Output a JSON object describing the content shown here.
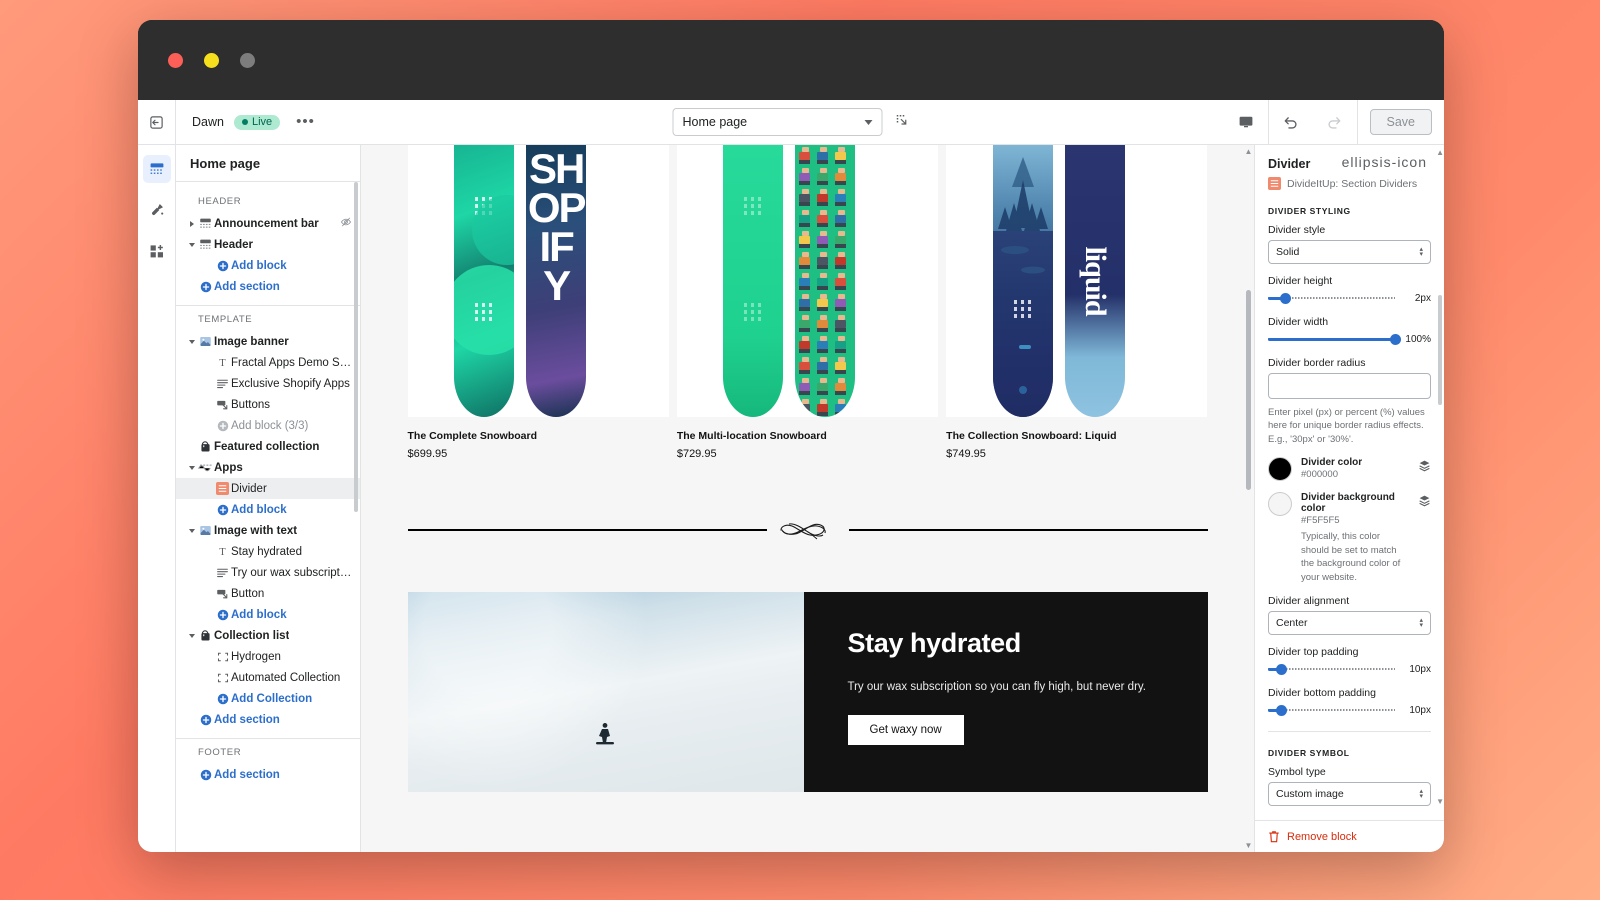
{
  "window": {
    "controls": [
      "close",
      "minimize",
      "maximize"
    ]
  },
  "topbar": {
    "back_icon": "exit-icon",
    "theme_name": "Dawn",
    "status_badge": "Live",
    "more_label": "•••",
    "page_selector": {
      "value": "Home page",
      "icon": "chevron-down-icon"
    },
    "resize_icon": "resize-handle-icon",
    "preview_icon": "desktop-icon",
    "undo_icon": "undo-icon",
    "redo_icon": "redo-icon",
    "save_label": "Save",
    "save_enabled": false
  },
  "rail": {
    "items": [
      {
        "name": "sections-icon",
        "label": "Sections",
        "active": true
      },
      {
        "name": "theme-settings-icon",
        "label": "Theme settings",
        "active": false
      },
      {
        "name": "app-embeds-icon",
        "label": "App embeds",
        "active": false
      }
    ]
  },
  "sidebar": {
    "title": "Home page",
    "groups": [
      {
        "label": "HEADER",
        "rows": [
          {
            "label": "Announcement bar",
            "icon": "section-icon",
            "twisty": "right",
            "indent": 0,
            "bold": true,
            "trailing_icon": "eye-off-icon"
          },
          {
            "label": "Header",
            "icon": "section-icon",
            "twisty": "down",
            "indent": 0,
            "bold": true
          },
          {
            "label": "Add block",
            "icon": "plus-circle-icon",
            "indent": 2,
            "style": "link"
          },
          {
            "label": "Add section",
            "icon": "plus-circle-icon",
            "indent": 1,
            "style": "link"
          }
        ]
      },
      {
        "label": "TEMPLATE",
        "rows": [
          {
            "label": "Image banner",
            "icon": "image-icon",
            "twisty": "down",
            "indent": 0,
            "bold": true
          },
          {
            "label": "Fractal Apps Demo Store",
            "icon": "text-icon",
            "indent": 2
          },
          {
            "label": "Exclusive Shopify Apps",
            "icon": "paragraph-icon",
            "indent": 2
          },
          {
            "label": "Buttons",
            "icon": "button-icon",
            "indent": 2
          },
          {
            "label": "Add block (3/3)",
            "icon": "plus-circle-icon",
            "indent": 2,
            "style": "muted"
          },
          {
            "label": "Featured collection",
            "icon": "collection-icon",
            "indent": 1,
            "bold": true
          },
          {
            "label": "Apps",
            "icon": "apps-icon",
            "twisty": "down",
            "indent": 0,
            "bold": true
          },
          {
            "label": "Divider",
            "icon": "divider-app-icon",
            "indent": 2,
            "selected": true
          },
          {
            "label": "Add block",
            "icon": "plus-circle-icon",
            "indent": 2,
            "style": "link"
          },
          {
            "label": "Image with text",
            "icon": "image-icon",
            "twisty": "down",
            "indent": 0,
            "bold": true
          },
          {
            "label": "Stay hydrated",
            "icon": "text-icon",
            "indent": 2
          },
          {
            "label": "Try our wax subscription so …",
            "icon": "paragraph-icon",
            "indent": 2
          },
          {
            "label": "Button",
            "icon": "button-icon",
            "indent": 2
          },
          {
            "label": "Add block",
            "icon": "plus-circle-icon",
            "indent": 2,
            "style": "link"
          },
          {
            "label": "Collection list",
            "icon": "collection-icon",
            "twisty": "down",
            "indent": 0,
            "bold": true
          },
          {
            "label": "Hydrogen",
            "icon": "placeholder-icon",
            "indent": 2
          },
          {
            "label": "Automated Collection",
            "icon": "placeholder-icon",
            "indent": 2
          },
          {
            "label": "Add Collection",
            "icon": "plus-circle-icon",
            "indent": 2,
            "style": "link"
          },
          {
            "label": "Add section",
            "icon": "plus-circle-icon",
            "indent": 1,
            "style": "link"
          }
        ]
      },
      {
        "label": "FOOTER",
        "rows": [
          {
            "label": "Add section",
            "icon": "plus-circle-icon",
            "indent": 1,
            "style": "link"
          }
        ]
      }
    ]
  },
  "preview": {
    "products": [
      {
        "title": "The Complete Snowboard",
        "price": "$699.95"
      },
      {
        "title": "The Multi-location Snowboard",
        "price": "$729.95"
      },
      {
        "title": "The Collection Snowboard: Liquid",
        "price": "$749.95"
      }
    ],
    "divider": {
      "symbol": "flourish-ornament",
      "color": "#000000"
    },
    "image_with_text": {
      "heading": "Stay hydrated",
      "paragraph": "Try our wax subscription so you can fly high, but never dry.",
      "button": "Get waxy now"
    }
  },
  "inspector": {
    "title": "Divider",
    "app_name": "DivideItUp: Section Dividers",
    "app_icon": "divider-app-icon",
    "more_icon": "ellipsis-icon",
    "section_styling_label": "DIVIDER STYLING",
    "divider_style": {
      "label": "Divider style",
      "value": "Solid"
    },
    "divider_height": {
      "label": "Divider height",
      "value": "2px",
      "percent": 14
    },
    "divider_width": {
      "label": "Divider width",
      "value": "100%",
      "percent": 100
    },
    "border_radius": {
      "label": "Divider border radius",
      "value": "",
      "help": "Enter pixel (px) or percent (%) values here for unique border radius effects. E.g., '30px' or '30%'."
    },
    "divider_color": {
      "label": "Divider color",
      "hex": "#000000",
      "swatch": "#000000"
    },
    "divider_background_color": {
      "label": "Divider background color",
      "hex": "#F5F5F5",
      "swatch": "#F5F5F5",
      "help": "Typically, this color should be set to match the background color of your website."
    },
    "divider_alignment": {
      "label": "Divider alignment",
      "value": "Center"
    },
    "top_padding": {
      "label": "Divider top padding",
      "value": "10px",
      "percent": 11
    },
    "bottom_padding": {
      "label": "Divider bottom padding",
      "value": "10px",
      "percent": 11
    },
    "section_symbol_label": "DIVIDER SYMBOL",
    "symbol_type": {
      "label": "Symbol type",
      "value": "Custom image"
    },
    "remove_label": "Remove block",
    "remove_icon": "trash-icon",
    "accent_color": "#2c6ecb",
    "danger_color": "#d72c0d"
  }
}
